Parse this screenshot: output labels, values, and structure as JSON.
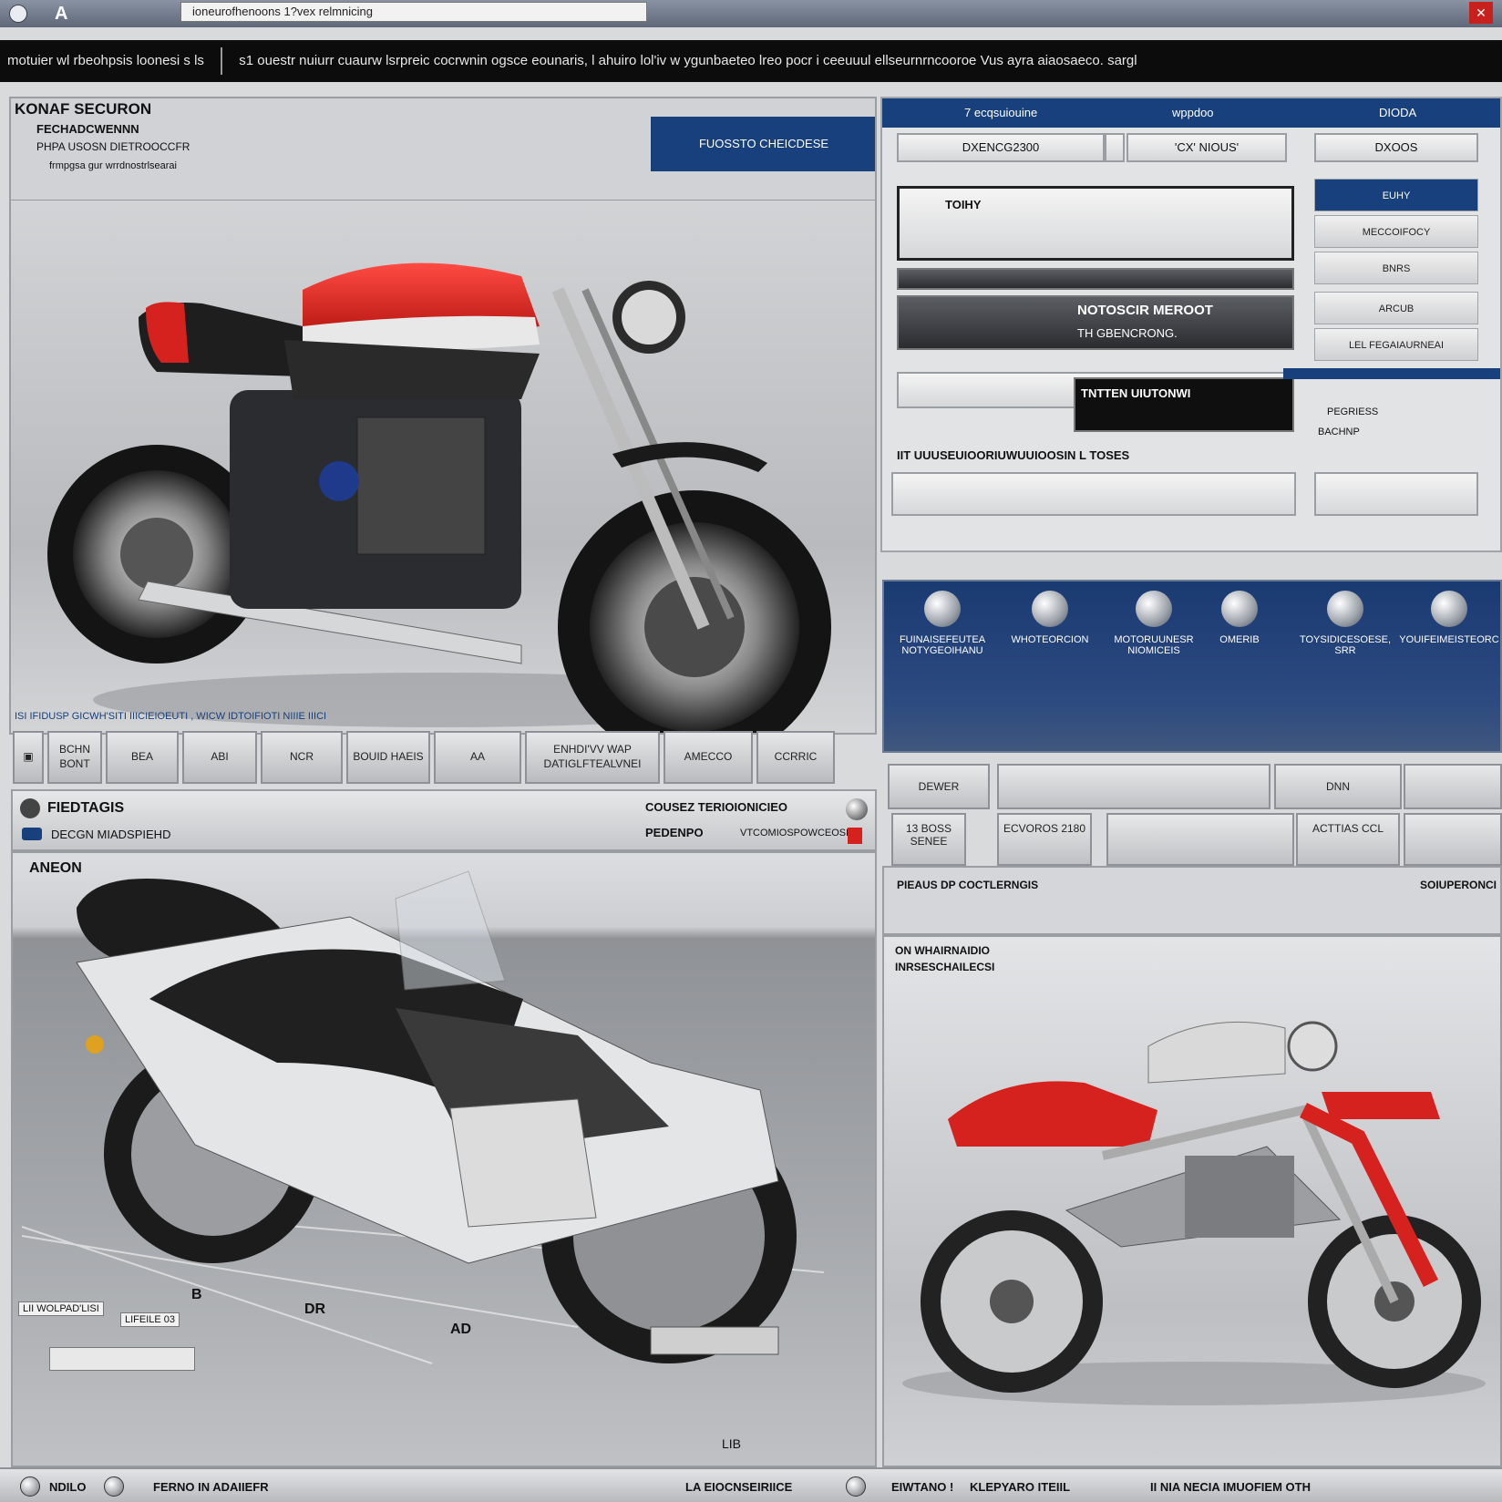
{
  "titlebar": {
    "address": "ioneurofhenoons 1?vex relmnicing"
  },
  "ticker": {
    "text_left": "motuier wl rbeohpsis loonesi s ls",
    "text_right": "s1 ouestr nuiurr cuaurw lsrpreic cocrwnin ogsce eounaris, l ahuiro lol'iv w ygunbaeteo lreo pocr i ceeuuul ellseurnrncooroe Vus ayra aiaosaeco. sargl"
  },
  "top_left": {
    "title": "KONAF SECURON",
    "line1": "FECHADCWENNN",
    "line2": "PHPA USOSN DIETROOCCFR",
    "line3": "frmpgsa gur wrrdnostrlsearai",
    "blue_button": "FUOSSTO CHEICDESE",
    "caption": "ISI  IFIDUSP GICWH'SITI IIICIEIOEUTI , WICW IDTOIFIOTI NIIIE        IIICI"
  },
  "toolbar": {
    "buttons": [
      "BCHN BONT",
      "BEA",
      "ABI",
      "NCR",
      "BOUID HAEIS",
      "AA",
      "ENHDI'VV WAP DATIGLFTEALVNEI",
      "AMECCO",
      "CCRRIC"
    ]
  },
  "top_right": {
    "header_cols": [
      "7 ecqsuiouine",
      "wppdoo",
      "DIODA"
    ],
    "field1": "DXENCG2300",
    "field2": "'CX' NIOUS'",
    "field3": "DXOOS",
    "field_top_label": "TOIHY",
    "bar1_label": "NOTOSCIR MEROOT",
    "bar1_sub": "TH GBENCRONG.",
    "bar2_label": "TNTTEN UIUTONWI",
    "bar3_label": "IIT UUUSEUIOORIUWUUIOOSIN L TOSES",
    "side_buttons": [
      "EUHY",
      "MECCOIFOCY",
      "BNRS",
      "ARCUB",
      "LEL FEGAIAURNEAI",
      "PEGRIESS",
      "BACHNP"
    ]
  },
  "icon_band": {
    "items": [
      "FUINAISEFEUTEA NOTYGEOIHANU",
      "WHOTEORCION",
      "MOTORUUNESR NIOMICEIS",
      "OMERIB",
      "TOYSIDICESOESE, SRR",
      "YOUIFEIMEISTEORC"
    ]
  },
  "right_grid": {
    "row1": [
      "DEWER",
      "",
      "DNN",
      ""
    ],
    "row2": [
      "13 BOSS SENEE",
      "ECVOROS 2180",
      "",
      "ACTTIAS CCL",
      ""
    ],
    "mid_left": "PIEAUS DP COCTLERNGIS",
    "mid_right": "SOIUPERONCI"
  },
  "bottom_right": {
    "label1": "ON WHAIRNAIDIO",
    "label2": "INRSESCHAILECSI"
  },
  "bottom_left": {
    "header_title": "FIEDTAGIS",
    "header_sub": "DECGN MIADSPIEHD",
    "header_right_title": "COUSEZ TERIOIONICIEO",
    "header_right_sub": "PEDENPO",
    "header_right_sub2": "VTCOMIOSPOWCEOSE",
    "panel_title": "ANEON",
    "annotations": [
      "LII WOLPAD'LISI",
      "LIFEILE 03",
      "DR",
      "AD",
      "LIB",
      "B"
    ]
  },
  "statusbar": {
    "left1": "NDILO",
    "left2": "FERNO IN ADAIIEFR",
    "mid": "LA EIOCNSEIRIICE",
    "right1": "EIWTANO !",
    "right2": "KLEPYARO ITEIIL",
    "right3": "II NIA NECIA IMUOFIEM OTH"
  },
  "colors": {
    "brand_blue": "#17407c",
    "accent_red": "#d6221e",
    "panel_grey": "#cfd1d4"
  }
}
